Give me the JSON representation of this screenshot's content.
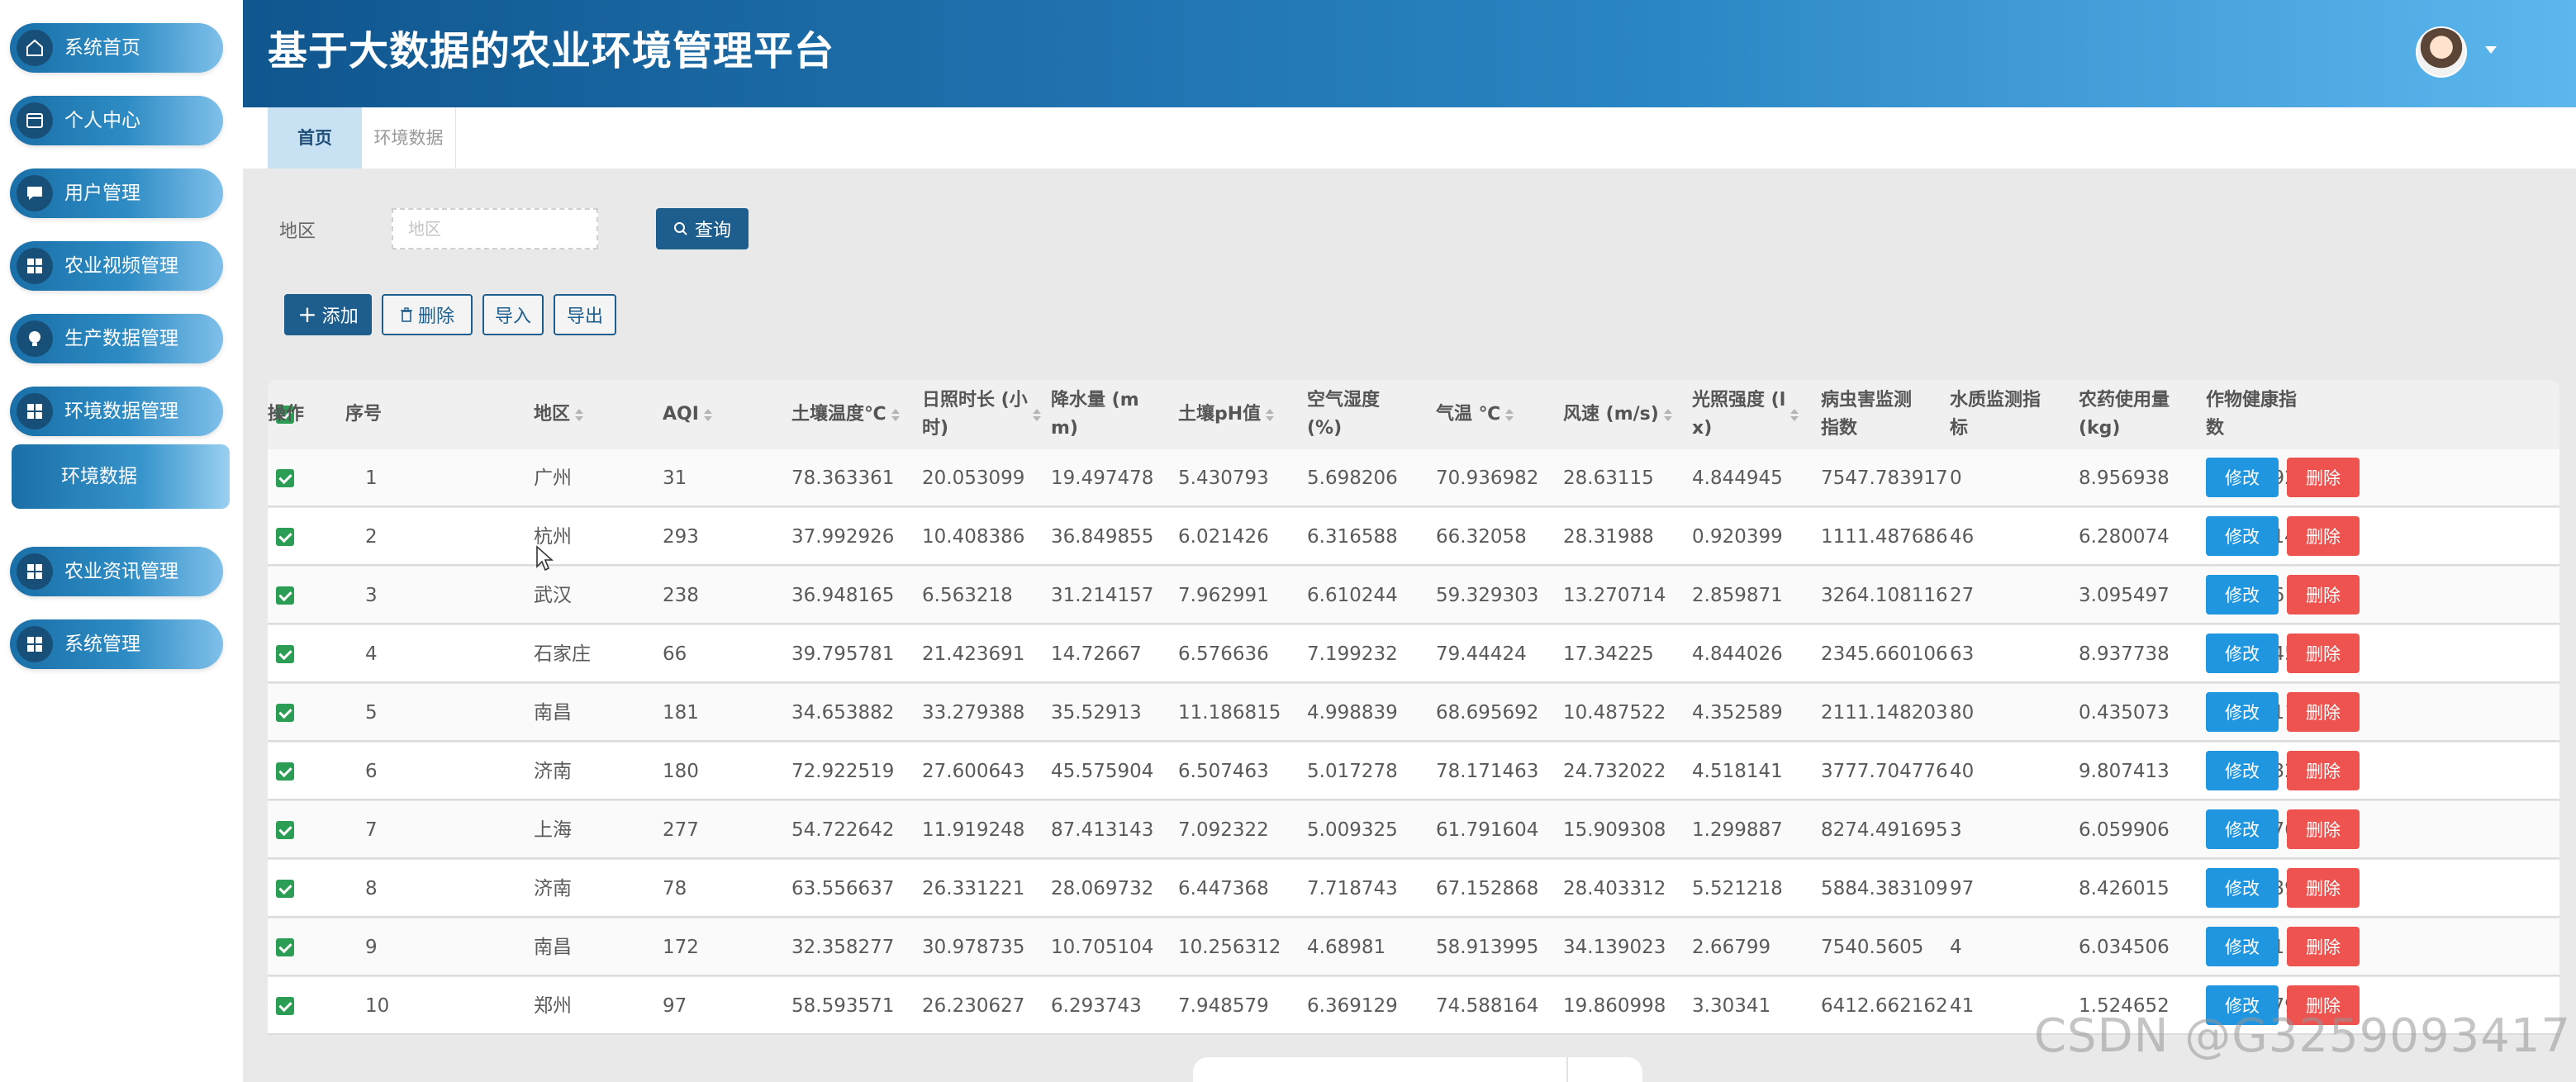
{
  "app": {
    "title": "基于大数据的农业环境管理平台"
  },
  "sidebar": {
    "items": [
      {
        "label": "系统首页",
        "icon": "home-icon"
      },
      {
        "label": "个人中心",
        "icon": "card-icon"
      },
      {
        "label": "用户管理",
        "icon": "chat-icon"
      },
      {
        "label": "农业视频管理",
        "icon": "grid-icon"
      },
      {
        "label": "生产数据管理",
        "icon": "bulb-icon"
      },
      {
        "label": "环境数据管理",
        "icon": "grid-icon"
      },
      {
        "label": "农业资讯管理",
        "icon": "grid-icon"
      },
      {
        "label": "系统管理",
        "icon": "grid-icon"
      }
    ],
    "active_sub": "环境数据"
  },
  "tabs": [
    {
      "label": "首页",
      "active": true
    },
    {
      "label": "环境数据",
      "active": false
    }
  ],
  "search": {
    "label": "地区",
    "placeholder": "地区",
    "button": "查询"
  },
  "actions": {
    "add": "添加",
    "delete": "删除",
    "import": "导入",
    "export": "导出"
  },
  "table": {
    "headers": [
      "序号",
      "地区",
      "AQI",
      "土壤温度℃",
      "日照时长 (小时)",
      "降水量 (mm)",
      "土壤pH值",
      "空气湿度 (%)",
      "气温 ℃",
      "风速 (m/s)",
      "光照强度 (lx)",
      "病虫害监测指数",
      "水质监测指标",
      "农药使用量 (kg)",
      "作物健康指数",
      "操作"
    ],
    "header_display": [
      [
        "序号"
      ],
      [
        "地区"
      ],
      [
        "AQI"
      ],
      [
        "土壤温度℃"
      ],
      [
        "日照时长 (小",
        "时)"
      ],
      [
        "降水量 (m",
        "m)"
      ],
      [
        "土壤pH值"
      ],
      [
        "空气湿度",
        "(%)"
      ],
      [
        "气温 ℃"
      ],
      [
        "风速 (m/s)"
      ],
      [
        "光照强度 (l",
        "x)"
      ],
      [
        "病虫害监测",
        "指数"
      ],
      [
        "水质监测指",
        "标"
      ],
      [
        "农药使用量",
        "(kg)"
      ],
      [
        "作物健康指",
        "数"
      ],
      [
        "操作"
      ]
    ],
    "rows": [
      [
        "1",
        "广州",
        "31",
        "78.363361",
        "20.053099",
        "19.497478",
        "5.430793",
        "5.698206",
        "70.936982",
        "28.63115",
        "4.844945",
        "7547.783917",
        "0",
        "8.956938",
        "1.548192"
      ],
      [
        "2",
        "杭州",
        "293",
        "37.992926",
        "10.408386",
        "36.849855",
        "6.021426",
        "6.316588",
        "66.32058",
        "28.31988",
        "0.920399",
        "1111.487686",
        "46",
        "6.280074",
        "1.400514"
      ],
      [
        "3",
        "武汉",
        "238",
        "36.948165",
        "6.563218",
        "31.214157",
        "7.962991",
        "6.610244",
        "59.329303",
        "13.270714",
        "2.859871",
        "3264.108116",
        "27",
        "3.095497",
        "0.34326"
      ],
      [
        "4",
        "石家庄",
        "66",
        "39.795781",
        "21.423691",
        "14.72667",
        "6.576636",
        "7.199232",
        "79.44424",
        "17.34225",
        "4.844026",
        "2345.660106",
        "63",
        "8.937738",
        "0.560045"
      ],
      [
        "5",
        "南昌",
        "181",
        "34.653882",
        "33.279388",
        "35.52913",
        "11.186815",
        "4.998839",
        "68.695692",
        "10.487522",
        "4.352589",
        "2111.148203",
        "80",
        "0.435073",
        "0.216011"
      ],
      [
        "6",
        "济南",
        "180",
        "72.922519",
        "27.600643",
        "45.575904",
        "6.507463",
        "5.017278",
        "78.171463",
        "24.732022",
        "4.518141",
        "3777.704776",
        "40",
        "9.807413",
        "0.206432"
      ],
      [
        "7",
        "上海",
        "277",
        "54.722642",
        "11.919248",
        "87.413143",
        "7.092322",
        "5.009325",
        "61.791604",
        "15.909308",
        "1.299887",
        "8274.491695",
        "3",
        "6.059906",
        "1.155076"
      ],
      [
        "8",
        "济南",
        "78",
        "63.556637",
        "26.331221",
        "28.069732",
        "6.447368",
        "7.718743",
        "67.152868",
        "28.403312",
        "5.521218",
        "5884.383109",
        "97",
        "8.426015",
        "1.821039"
      ],
      [
        "9",
        "南昌",
        "172",
        "32.358277",
        "30.978735",
        "10.705104",
        "10.256312",
        "4.68981",
        "58.913995",
        "34.139023",
        "2.66799",
        "7540.5605",
        "4",
        "6.034506",
        "0.28551"
      ],
      [
        "10",
        "郑州",
        "97",
        "58.593571",
        "26.230627",
        "6.293743",
        "7.948579",
        "6.369129",
        "74.588164",
        "19.860998",
        "3.30341",
        "6412.662162",
        "41",
        "1.524652",
        "1.978979"
      ]
    ],
    "row_actions": {
      "edit": "修改",
      "delete": "删除"
    }
  },
  "watermark": "CSDN @G3259093417"
}
